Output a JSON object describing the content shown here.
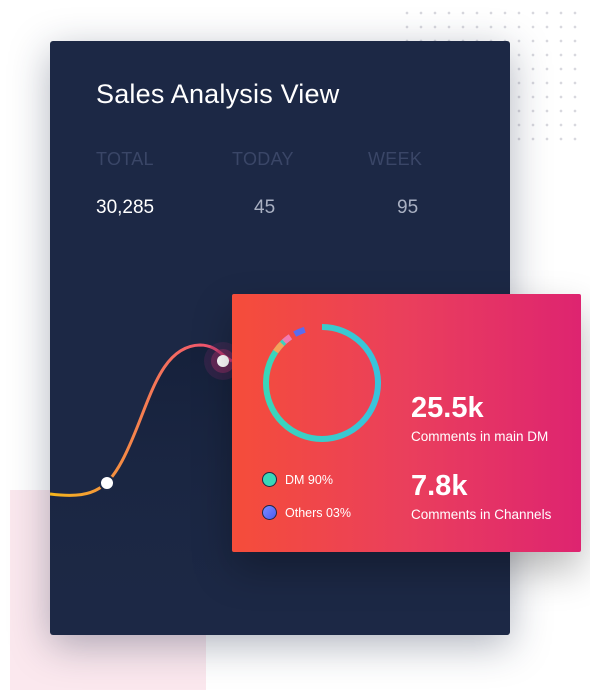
{
  "title": "Sales Analysis View",
  "stats": [
    {
      "label": "TOTAL",
      "value": "30,285"
    },
    {
      "label": "TODAY",
      "value": "45"
    },
    {
      "label": "WEEK",
      "value": "95"
    }
  ],
  "donut": {
    "segments": [
      {
        "name": "DM",
        "percent": 90,
        "color": "#3ad6b9"
      },
      {
        "name": "Others",
        "percent": 3,
        "color": "#5a6cf0"
      }
    ]
  },
  "legend": [
    {
      "label": "DM 90%",
      "color": "#3ad6b9"
    },
    {
      "label": "Others 03%",
      "color": "#6c7cf5"
    }
  ],
  "metrics": [
    {
      "value": "25.5k",
      "label": "Comments in main DM"
    },
    {
      "value": "7.8k",
      "label": "Comments in Channels"
    }
  ],
  "colors": {
    "card_bg": "#1c2845",
    "curve_start": "#f5b61c",
    "curve_end": "#f0457a",
    "gradient_start": "#f54d3a",
    "gradient_end": "#de2470"
  }
}
